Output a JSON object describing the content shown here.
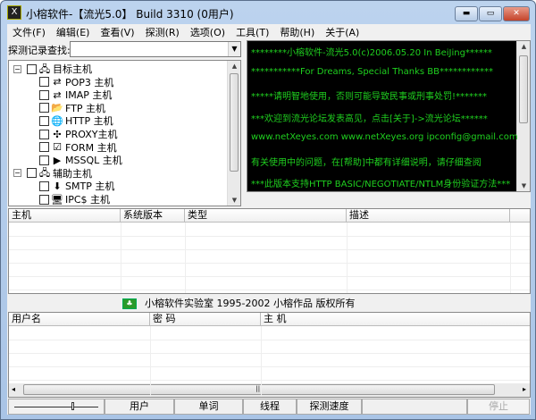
{
  "window": {
    "title": "小榕软件-【流光5.0】 Build 3310 (0用户)"
  },
  "menu": [
    "文件(F)",
    "编辑(E)",
    "查看(V)",
    "探测(R)",
    "选项(O)",
    "工具(T)",
    "帮助(H)",
    "关于(A)"
  ],
  "search": {
    "label": "探测记录查找:",
    "value": ""
  },
  "tree": [
    {
      "label": "目标主机",
      "level": 0,
      "icon": "network-hosts-icon",
      "glyph": "🖧"
    },
    {
      "label": "POP3 主机",
      "level": 1,
      "icon": "pop3-icon",
      "glyph": "⇄"
    },
    {
      "label": "IMAP 主机",
      "level": 1,
      "icon": "imap-icon",
      "glyph": "⇄"
    },
    {
      "label": "FTP  主机",
      "level": 1,
      "icon": "ftp-icon",
      "glyph": "📂"
    },
    {
      "label": "HTTP 主机",
      "level": 1,
      "icon": "globe-icon",
      "glyph": "🌐"
    },
    {
      "label": "PROXY主机",
      "level": 1,
      "icon": "proxy-icon",
      "glyph": "✣"
    },
    {
      "label": "FORM 主机",
      "level": 1,
      "icon": "form-icon",
      "glyph": "☑"
    },
    {
      "label": "MSSQL  主机",
      "level": 1,
      "icon": "mssql-icon",
      "glyph": "▶"
    },
    {
      "label": "辅助主机",
      "level": 0,
      "icon": "network-hosts-icon",
      "glyph": "🖧"
    },
    {
      "label": "SMTP 主机",
      "level": 1,
      "icon": "smtp-icon",
      "glyph": "⬇"
    },
    {
      "label": "IPC$ 主机",
      "level": 1,
      "icon": "ipc-icon",
      "glyph": "🖥"
    }
  ],
  "console": [
    "********小榕软件-流光5.0(c)2006.05.20 In BeiJing******",
    "***********For Dreams, Special Thanks BB************",
    "*****请明智地使用，否则可能导致民事或刑事处罚!*******",
    "***欢迎到流光论坛发表高见，点击[关于]->流光论坛******",
    "www.netXeyes.com www.netXeyes.org ipconfig@gmail.com",
    "有关使用中的问题，在[帮助]中都有详细说明，请仔细查阅",
    "***此版本支持HTTP BASIC/NEGOTIATE/NTLM身份验证方法***"
  ],
  "hosts_table": {
    "columns": [
      "主机",
      "系统版本",
      "类型",
      "描述"
    ],
    "rows": []
  },
  "banner": "小榕软件实验室 1995-2002 小榕作品 版权所有",
  "users_table": {
    "columns": [
      "用户名",
      "密 码",
      "主 机"
    ],
    "rows": []
  },
  "status": {
    "slider_level": 0.7,
    "users": "用户",
    "words": "单词",
    "threads": "线程",
    "speed": "探测速度",
    "stop": "停止"
  },
  "colors": {
    "console_bg": "#000000",
    "console_text": "#1fd01f"
  }
}
